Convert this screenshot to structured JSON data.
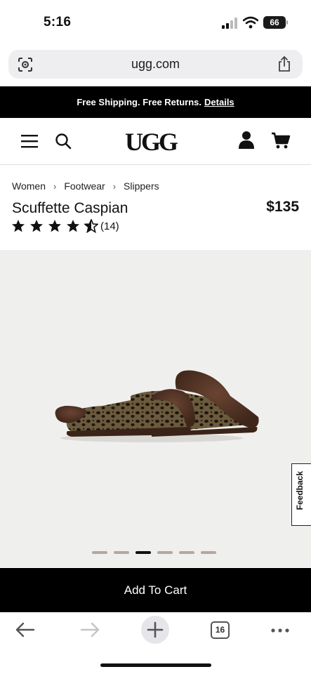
{
  "status": {
    "time": "5:16",
    "battery": "66"
  },
  "browser": {
    "url": "ugg.com",
    "tab_count": "16"
  },
  "promo": {
    "text": "Free Shipping. Free Returns.",
    "link": "Details"
  },
  "site": {
    "logo": "UGG"
  },
  "breadcrumb": [
    "Women",
    "Footwear",
    "Slippers"
  ],
  "product": {
    "title": "Scuffette Caspian",
    "price": "$135",
    "rating": 4.5,
    "review_count": "(14)"
  },
  "gallery": {
    "image_count": 6,
    "active_index": 2,
    "feedback_label": "Feedback"
  },
  "cart": {
    "add_label": "Add To Cart"
  },
  "icons": [
    "lens-icon",
    "share-icon",
    "menu-icon",
    "search-icon",
    "account-icon",
    "cart-icon",
    "star-icon",
    "back-icon",
    "forward-icon",
    "plus-icon",
    "more-icon"
  ],
  "colors": {
    "banner": "#000000",
    "gallery_bg": "#efefee",
    "dot": "#b5a79a",
    "slipper_fur": "#4a2e1f"
  }
}
